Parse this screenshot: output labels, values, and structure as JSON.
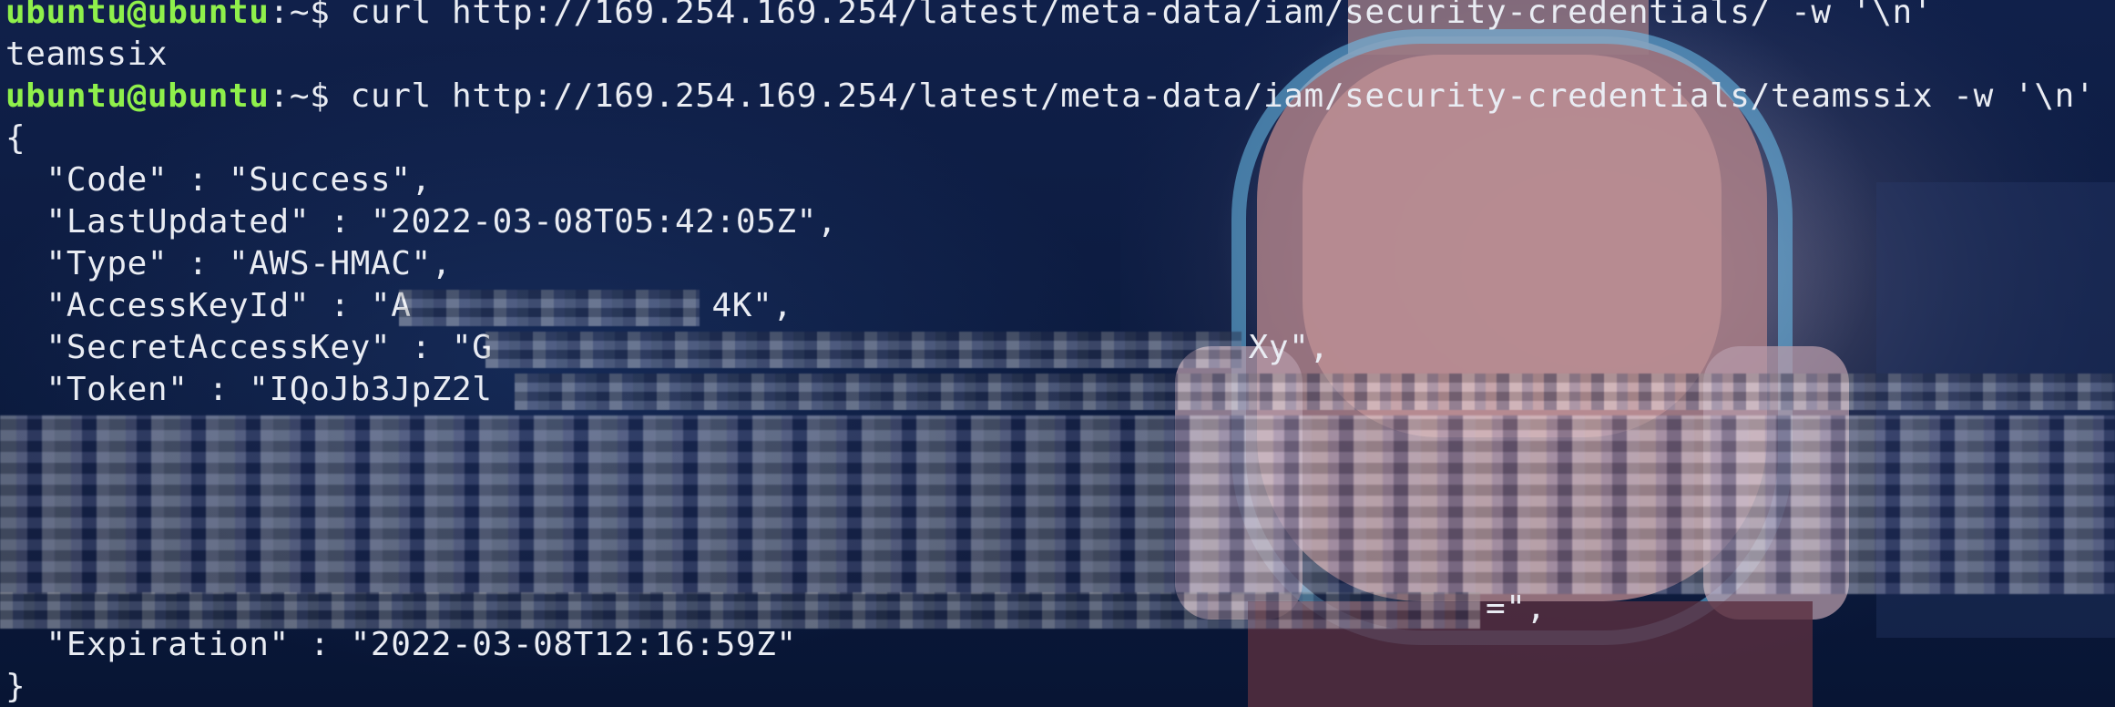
{
  "terminal": {
    "lines": [
      {
        "user": "ubuntu@ubuntu",
        "path": ":~$ ",
        "command": "curl http://169.254.169.254/latest/meta-data/iam/security-credentials/ -w '\\n'"
      },
      {
        "output": "teamssix"
      },
      {
        "user": "ubuntu@ubuntu",
        "path": ":~$ ",
        "command": "curl http://169.254.169.254/latest/meta-data/iam/security-credentials/teamssix -w '\\n'"
      }
    ],
    "json": {
      "open_brace": "{",
      "code": "  \"Code\" : \"Success\",",
      "last_updated": "  \"LastUpdated\" : \"2022-03-08T05:42:05Z\",",
      "type": "  \"Type\" : \"AWS-HMAC\",",
      "access_key_prefix": "  \"AccessKeyId\" : \"A",
      "access_key_suffix": "4K\",",
      "secret_key_prefix": "  \"SecretAccessKey\" : \"G",
      "secret_key_suffix": "Xy\",",
      "token_prefix": "  \"Token\" : \"IQoJb3JpZ2l",
      "token_end": "=\",",
      "expiration": "  \"Expiration\" : \"2022-03-08T12:16:59Z\"",
      "close_brace": "}"
    },
    "colors": {
      "prompt_user": "#8ff04b",
      "text": "#e9ecf3",
      "background": "#0c1a3a"
    }
  }
}
